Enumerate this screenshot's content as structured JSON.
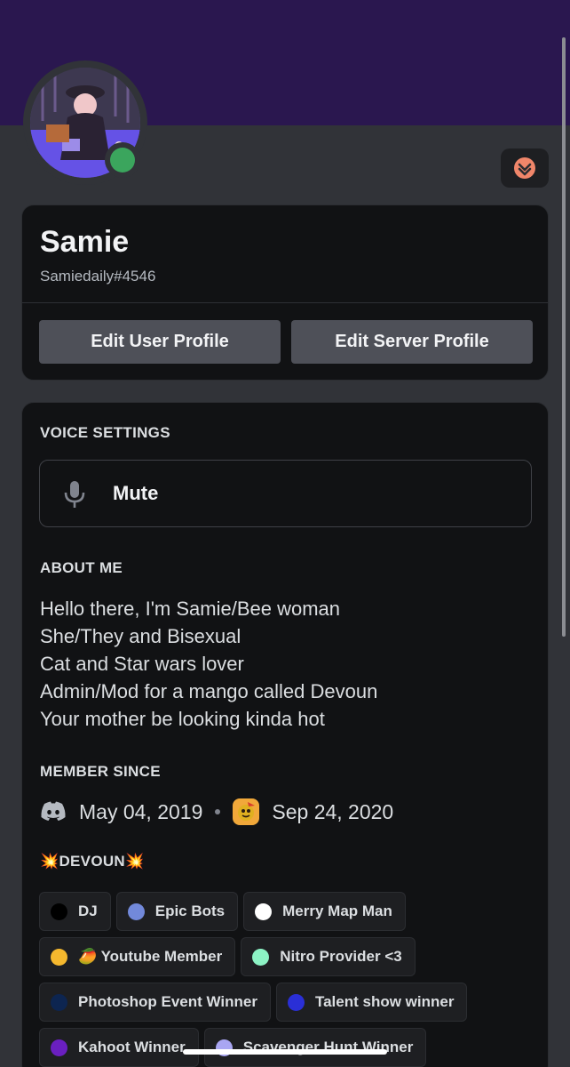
{
  "profile": {
    "display_name": "Samie",
    "tag": "Samiedaily#4546",
    "status_color": "#3ba55d",
    "banner_color": "#2a174f"
  },
  "actions": {
    "edit_user_profile": "Edit User Profile",
    "edit_server_profile": "Edit Server Profile"
  },
  "voice": {
    "title": "VOICE SETTINGS",
    "mute_label": "Mute",
    "icon": "microphone-icon"
  },
  "about": {
    "title": "ABOUT ME",
    "lines": [
      "Hello there, I'm Samie/Bee woman",
      "She/They and Bisexual",
      "Cat and Star wars lover",
      "Admin/Mod for a mango called Devoun",
      "Your mother be looking kinda hot"
    ]
  },
  "member_since": {
    "title": "MEMBER SINCE",
    "discord_date": "May 04, 2019",
    "server_date": "Sep 24, 2020",
    "discord_icon": "discord-logo-icon",
    "server_icon": "server-icon"
  },
  "roles": {
    "title": "💥DEVOUN💥",
    "items": [
      {
        "label": "DJ",
        "color": "#000000"
      },
      {
        "label": "Epic Bots",
        "color": "#7289da"
      },
      {
        "label": "Merry Map Man",
        "color": "#ffffff"
      },
      {
        "label": "🥭 Youtube Member",
        "color": "#f5b82e"
      },
      {
        "label": "Nitro Provider <3",
        "color": "#8cf2c4"
      },
      {
        "label": "Photoshop Event Winner",
        "color": "#0d2550"
      },
      {
        "label": "Talent show winner",
        "color": "#2a2fd6"
      },
      {
        "label": "Kahoot Winner",
        "color": "#6a1fc0"
      },
      {
        "label": "Scavenger Hunt Winner",
        "color": "#a9a6f2"
      }
    ]
  }
}
